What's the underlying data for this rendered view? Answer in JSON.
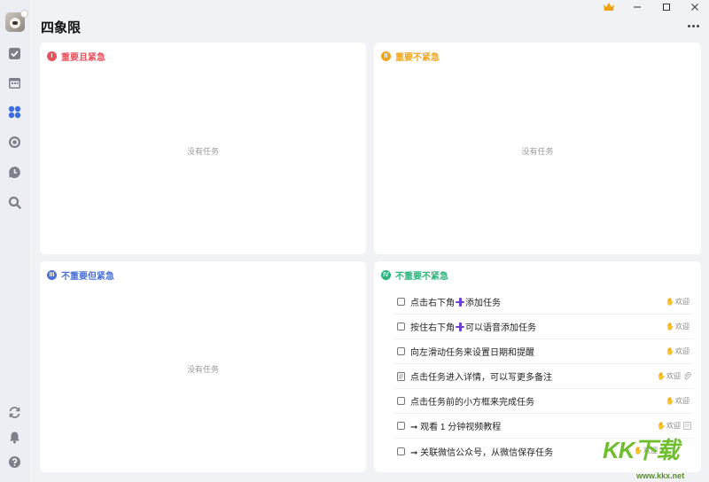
{
  "app": {
    "title": "四象限"
  },
  "quadrants": {
    "q1": {
      "badge": "I",
      "title": "重要且紧急",
      "color": "#e8535c",
      "empty": "没有任务"
    },
    "q2": {
      "badge": "II",
      "title": "重要不紧急",
      "color": "#f0a61c",
      "empty": "没有任务"
    },
    "q3": {
      "badge": "III",
      "title": "不重要但紧急",
      "color": "#4a72d6",
      "empty": "没有任务"
    },
    "q4": {
      "badge": "IV",
      "title": "不重要不紧急",
      "color": "#2ab57d"
    }
  },
  "tasks": [
    {
      "pre": "点击右下角",
      "plus": true,
      "post": "添加任务",
      "tag": "欢迎"
    },
    {
      "pre": "按住右下角",
      "plus": true,
      "post": "可以语音添加任务",
      "tag": "欢迎"
    },
    {
      "pre": "向左滑动任务来设置日期和提醒",
      "plus": false,
      "post": "",
      "tag": "欢迎"
    },
    {
      "pre": "点击任务进入详情，可以写更多备注",
      "plus": false,
      "post": "",
      "tag": "欢迎"
    },
    {
      "pre": "点击任务前的小方框来完成任务",
      "plus": false,
      "post": "",
      "tag": "欢迎"
    },
    {
      "pre": "➞ 观看 1 分钟视频教程",
      "plus": false,
      "post": "",
      "tag": "欢迎"
    },
    {
      "pre": "➞ 关联微信公众号，从微信保存任务",
      "plus": false,
      "post": "",
      "tag": "欢迎"
    }
  ],
  "watermark": {
    "brand": "KK下载",
    "url": "www.kkx.net"
  },
  "icons": {
    "sidebar": [
      "check-square-icon",
      "calendar-icon",
      "quadrant-icon",
      "focus-icon",
      "clock-icon",
      "search-icon",
      "sync-icon",
      "bell-icon",
      "help-icon"
    ],
    "window": [
      "crown-icon",
      "minimize-icon",
      "maximize-icon",
      "close-icon"
    ]
  }
}
